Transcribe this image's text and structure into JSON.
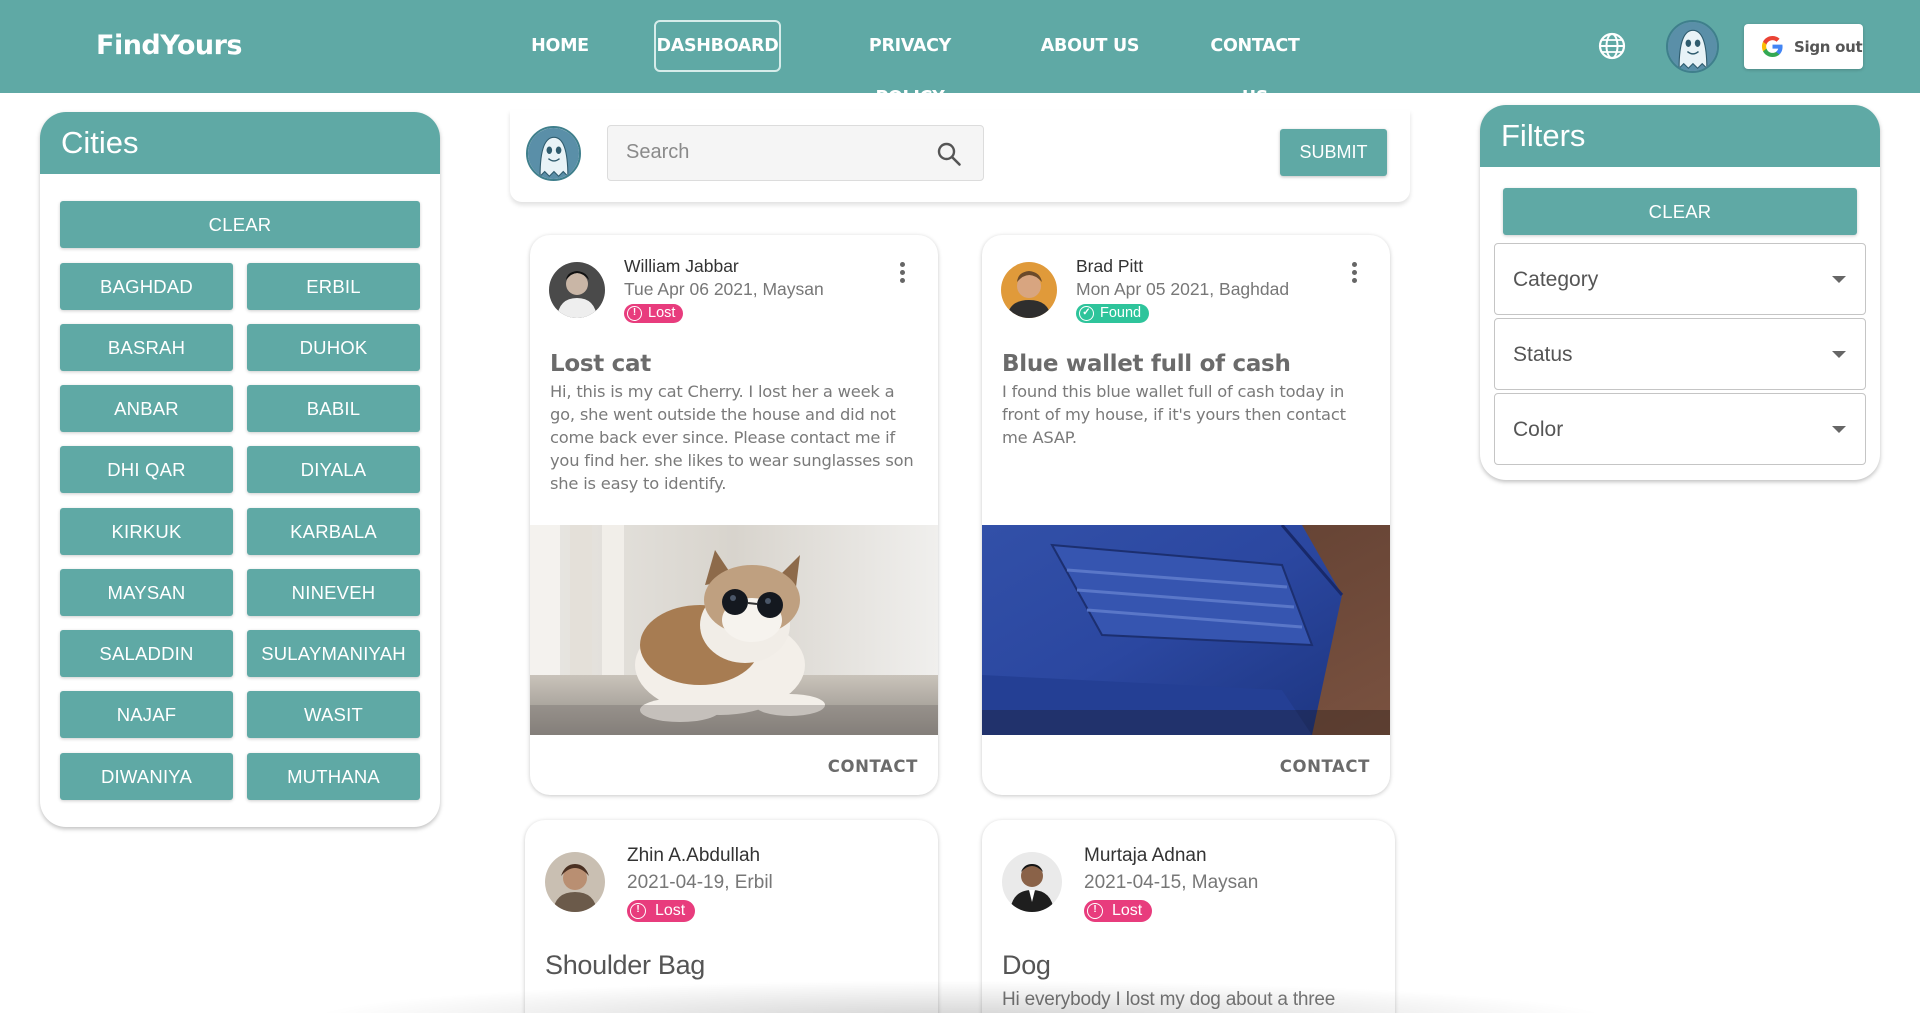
{
  "header": {
    "brand": "FindYours",
    "nav": [
      {
        "label": "HOME"
      },
      {
        "label": "DASHBOARD",
        "active": true
      },
      {
        "label": "PRIVACY POLICY"
      },
      {
        "label": "ABOUT US"
      },
      {
        "label": "CONTACT US"
      }
    ],
    "language_icon": "globe-icon",
    "signout_label": "Sign out"
  },
  "cities": {
    "title": "Cities",
    "clear_label": "CLEAR",
    "items": [
      "BAGHDAD",
      "ERBIL",
      "BASRAH",
      "DUHOK",
      "ANBAR",
      "BABIL",
      "DHI QAR",
      "DIYALA",
      "KIRKUK",
      "KARBALA",
      "MAYSAN",
      "NINEVEH",
      "SALADDIN",
      "SULAYMANIYAH",
      "NAJAF",
      "WASIT",
      "DIWANIYA",
      "MUTHANA"
    ]
  },
  "search": {
    "placeholder": "Search",
    "submit_label": "SUBMIT"
  },
  "filters": {
    "title": "Filters",
    "clear_label": "CLEAR",
    "selects": [
      {
        "label": "Category"
      },
      {
        "label": "Status"
      },
      {
        "label": "Color"
      }
    ]
  },
  "posts": [
    {
      "author": "William Jabbar",
      "meta": "Tue Apr 06 2021, Maysan",
      "status": "Lost",
      "title": "Lost cat",
      "body": "Hi, this is my cat Cherry. I lost her a week a go, she went outside the house and did not come back ever since. Please contact me if you find her. she likes to wear sunglasses son she is easy to identify.",
      "action": "CONTACT"
    },
    {
      "author": "Brad Pitt",
      "meta": "Mon Apr 05 2021, Baghdad",
      "status": "Found",
      "title": "Blue wallet full of cash",
      "body": "I found this blue wallet full of cash today in front of my house, if it's yours then contact me ASAP.",
      "action": "CONTACT"
    },
    {
      "author": "Zhin A.Abdullah",
      "meta": "2021-04-19, Erbil",
      "status": "Lost",
      "title": "Shoulder Bag"
    },
    {
      "author": "Murtaja Adnan",
      "meta": "2021-04-15, Maysan",
      "status": "Lost",
      "title": "Dog",
      "body": "Hi everybody I lost my dog about a three weeks"
    }
  ],
  "colors": {
    "primary": "#5fa9a5",
    "lost": "#e83c7d",
    "found": "#2ec49b"
  }
}
